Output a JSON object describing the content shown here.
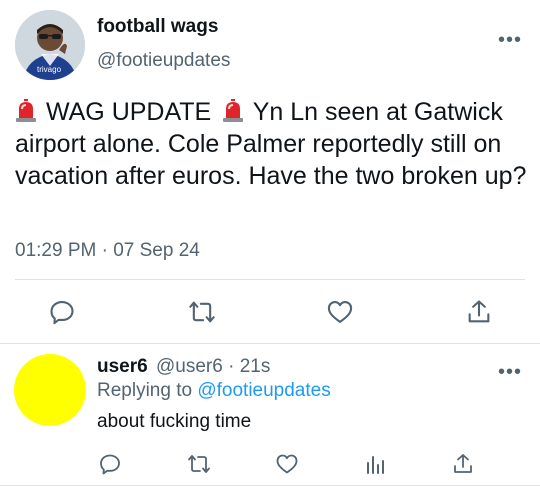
{
  "tweet": {
    "display_name": "football wags",
    "handle": "@footieupdates",
    "avatar_text": "trivago",
    "more_label": "•••",
    "emoji_icon": "police-light-icon",
    "text_part1": "WAG UPDATE",
    "text_part2": "Yn Ln seen at Gatwick airport alone. Cole Palmer reportedly still on vacation after euros. Have the two broken up?",
    "timestamp": "01:29 PM · 07 Sep 24",
    "actions": [
      "reply-icon",
      "retweet-icon",
      "like-icon",
      "share-icon"
    ]
  },
  "reply": {
    "display_name": "user6",
    "meta": "@user6 · 21s",
    "more_label": "•••",
    "replying_prefix": "Replying to",
    "replying_to": "@footieupdates",
    "text": "about fucking time",
    "avatar_color": "#ffff00",
    "actions": [
      "reply-icon",
      "retweet-icon",
      "like-icon",
      "analytics-icon",
      "share-icon"
    ]
  },
  "colors": {
    "text": "#0f1419",
    "secondary": "#536471",
    "link": "#1d9bf0",
    "divider": "#dfe3e7"
  }
}
